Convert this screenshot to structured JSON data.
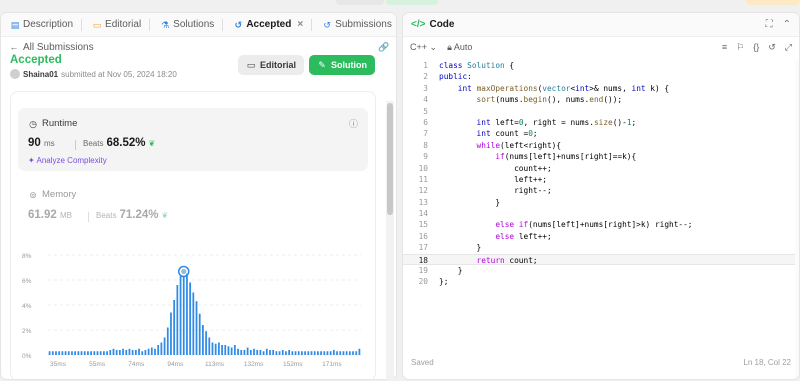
{
  "tabs": [
    {
      "label": "Description",
      "icon": "description-icon",
      "glyph": "▤",
      "color": "#2f7ee0"
    },
    {
      "label": "Editorial",
      "icon": "editorial-icon",
      "glyph": "▭",
      "color": "#f0a020"
    },
    {
      "label": "Solutions",
      "icon": "solutions-icon",
      "glyph": "⚗",
      "color": "#2f7ee0"
    },
    {
      "label": "Accepted",
      "icon": "history-icon",
      "glyph": "↺",
      "color": "#2f7ee0"
    },
    {
      "label": "Submissions",
      "icon": "submissions-icon",
      "glyph": "↺",
      "color": "#2f7ee0"
    }
  ],
  "nav": {
    "all_submissions": "All Submissions"
  },
  "result": {
    "status": "Accepted",
    "user": "Shaina01",
    "submitted": "submitted at Nov 05, 2024 18:20"
  },
  "buttons": {
    "editorial": "Editorial",
    "solution": "Solution"
  },
  "runtime": {
    "label": "Runtime",
    "value": "90",
    "unit": "ms",
    "beats_label": "Beats",
    "beats": "68.52%",
    "analyze": "Analyze Complexity"
  },
  "memory": {
    "label": "Memory",
    "value": "61.92",
    "unit": "MB",
    "beats_label": "Beats",
    "beats": "71.24%"
  },
  "chart_data": {
    "type": "bar",
    "y_ticks": [
      "8%",
      "6%",
      "4%",
      "2%",
      "0%"
    ],
    "ylim": [
      0,
      8
    ],
    "x_ticks": [
      "35ms",
      "55ms",
      "74ms",
      "94ms",
      "113ms",
      "132ms",
      "152ms",
      "171ms"
    ],
    "values": [
      0.3,
      0.3,
      0.3,
      0.3,
      0.3,
      0.3,
      0.3,
      0.3,
      0.3,
      0.3,
      0.3,
      0.3,
      0.3,
      0.3,
      0.3,
      0.3,
      0.3,
      0.3,
      0.3,
      0.4,
      0.5,
      0.4,
      0.4,
      0.5,
      0.4,
      0.5,
      0.4,
      0.4,
      0.5,
      0.3,
      0.4,
      0.5,
      0.6,
      0.5,
      0.8,
      1.0,
      1.4,
      2.2,
      3.4,
      4.4,
      5.6,
      6.3,
      6.6,
      6.5,
      5.8,
      5.0,
      4.3,
      3.3,
      2.4,
      1.9,
      1.4,
      1.0,
      0.9,
      1.0,
      0.8,
      0.8,
      0.7,
      0.6,
      0.8,
      0.5,
      0.4,
      0.4,
      0.6,
      0.4,
      0.5,
      0.4,
      0.4,
      0.3,
      0.5,
      0.4,
      0.4,
      0.3,
      0.3,
      0.4,
      0.3,
      0.4,
      0.3,
      0.3,
      0.3,
      0.3,
      0.3,
      0.3,
      0.3,
      0.3,
      0.3,
      0.3,
      0.3,
      0.3,
      0.3,
      0.4,
      0.3,
      0.3,
      0.3,
      0.3,
      0.3,
      0.3,
      0.3,
      0.5
    ],
    "highlight_index": 42,
    "bar_color": "#2f8be6"
  },
  "code": {
    "title": "Code",
    "language": "C++",
    "autosave": "Auto",
    "status_left": "Saved",
    "status_right": "Ln 18, Col 22",
    "current_line": 18,
    "lines": [
      [
        [
          "class ",
          "#0000c0"
        ],
        [
          "Solution ",
          "#267f99"
        ],
        [
          "{",
          "#000"
        ]
      ],
      [
        [
          "public:",
          "#0000c0"
        ]
      ],
      [
        [
          "    int ",
          "#0000c0"
        ],
        [
          "maxOperations",
          "#795e26"
        ],
        [
          "(",
          "#000"
        ],
        [
          "vector",
          "#267f99"
        ],
        [
          "<",
          "#000"
        ],
        [
          "int",
          "#0000c0"
        ],
        [
          ">& nums, ",
          "#000"
        ],
        [
          "int ",
          "#0000c0"
        ],
        [
          "k) {",
          "#000"
        ]
      ],
      [
        [
          "        sort",
          "#795e26"
        ],
        [
          "(nums.",
          "#000"
        ],
        [
          "begin",
          "#795e26"
        ],
        [
          "(), nums.",
          "#000"
        ],
        [
          "end",
          "#795e26"
        ],
        [
          "());",
          "#000"
        ]
      ],
      [
        [
          "",
          "#000"
        ]
      ],
      [
        [
          "        int ",
          "#0000c0"
        ],
        [
          "left=",
          "#000"
        ],
        [
          "0",
          "#098658"
        ],
        [
          ", right = nums.",
          "#000"
        ],
        [
          "size",
          "#795e26"
        ],
        [
          "()-",
          "#000"
        ],
        [
          "1",
          "#098658"
        ],
        [
          ";",
          "#000"
        ]
      ],
      [
        [
          "        int ",
          "#0000c0"
        ],
        [
          "count =",
          "#000"
        ],
        [
          "0",
          "#098658"
        ],
        [
          ";",
          "#000"
        ]
      ],
      [
        [
          "        while",
          "#af00db"
        ],
        [
          "(left<right){",
          "#000"
        ]
      ],
      [
        [
          "            if",
          "#af00db"
        ],
        [
          "(nums[left]+nums[right]==k){",
          "#000"
        ]
      ],
      [
        [
          "                count++;",
          "#000"
        ]
      ],
      [
        [
          "                left++;",
          "#000"
        ]
      ],
      [
        [
          "                right--;",
          "#000"
        ]
      ],
      [
        [
          "            }",
          "#000"
        ]
      ],
      [
        [
          "",
          "#000"
        ]
      ],
      [
        [
          "            else if",
          "#af00db"
        ],
        [
          "(nums[left]+nums[right]>k) right--;",
          "#000"
        ]
      ],
      [
        [
          "            else ",
          "#af00db"
        ],
        [
          "left++;",
          "#000"
        ]
      ],
      [
        [
          "        }",
          "#000"
        ]
      ],
      [
        [
          "        return ",
          "#af00db"
        ],
        [
          "count;",
          "#000"
        ]
      ],
      [
        [
          "    }",
          "#000"
        ]
      ],
      [
        [
          "};",
          "#000"
        ]
      ]
    ]
  }
}
